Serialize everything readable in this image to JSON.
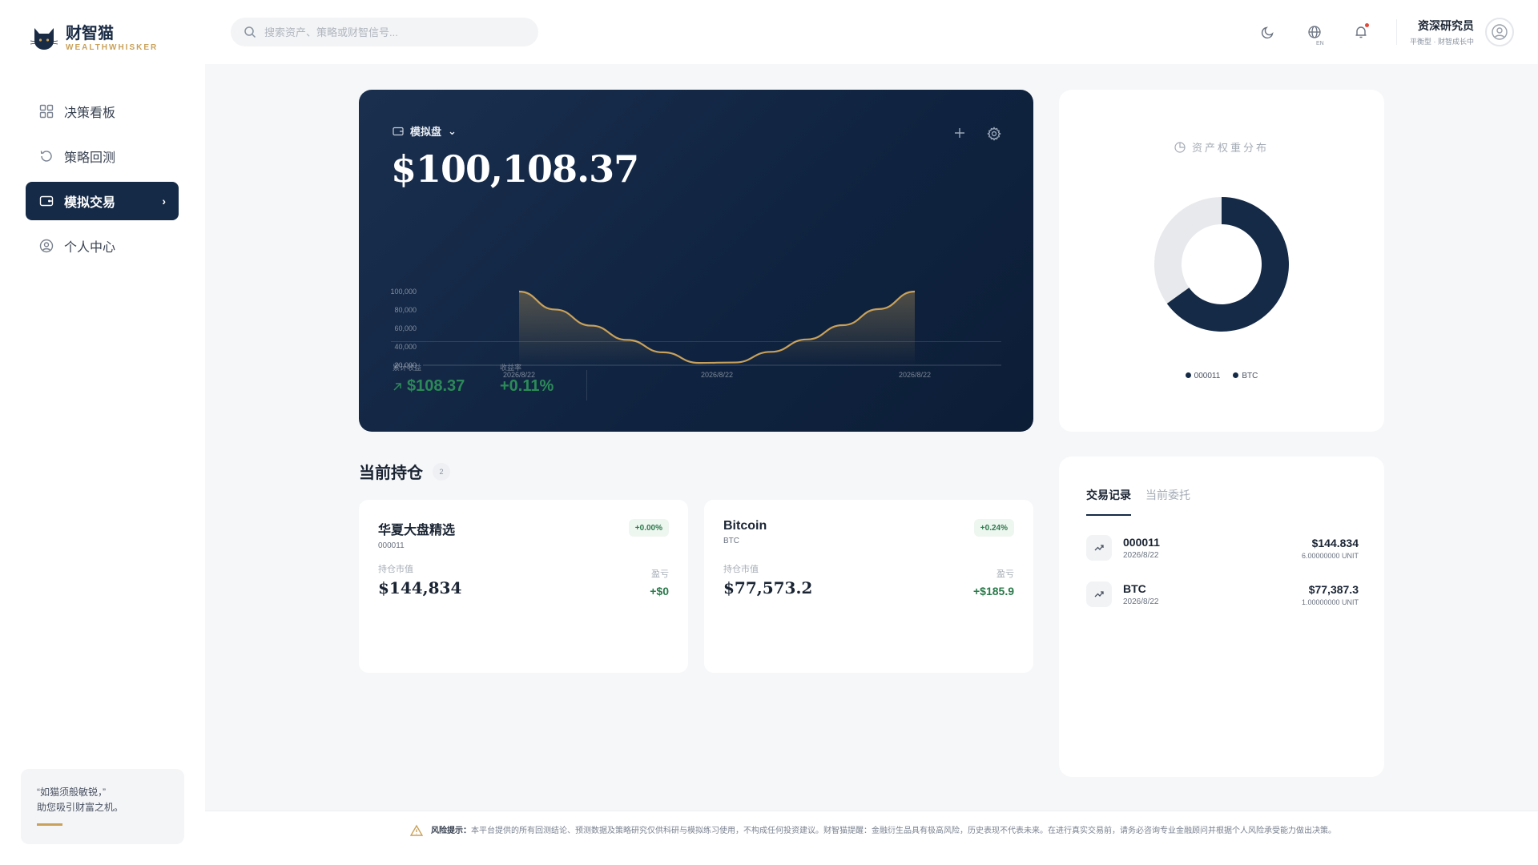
{
  "brand": {
    "name_cn": "财智猫",
    "name_en": "WEALTHWHISKER",
    "gold": "#c9a15a",
    "navy": "#152a47"
  },
  "sidebar": {
    "items": [
      {
        "label": "决策看板",
        "icon": "dashboard-icon"
      },
      {
        "label": "策略回测",
        "icon": "history-icon"
      },
      {
        "label": "模拟交易",
        "icon": "wallet-icon",
        "active": true
      },
      {
        "label": "个人中心",
        "icon": "user-circle-icon"
      }
    ],
    "quote_line1": "“如猫须般敏锐，”",
    "quote_line2": "助您吸引财富之机。"
  },
  "topbar": {
    "search_placeholder": "搜索资产、策略或财智信号...",
    "lang_sub": "EN",
    "user_name": "资深研究员",
    "user_sub": "平衡型 · 财智成长中"
  },
  "account": {
    "type_label": "模拟盘",
    "total_value": "$100,108.37",
    "stats": [
      {
        "label": "累计收益",
        "value": "$108.37"
      },
      {
        "label": "收益率",
        "value": "+0.11%"
      }
    ]
  },
  "chart_data": {
    "type": "area",
    "title": "",
    "xlabel": "",
    "ylabel": "",
    "x_ticks": [
      "2026/8/22",
      "2026/8/22",
      "2026/8/22"
    ],
    "y_ticks": [
      "100,000",
      "80,000",
      "60,000",
      "40,000",
      "20,000"
    ],
    "ylim": [
      20000,
      100000
    ],
    "series": [
      {
        "values": [
          100000,
          80500,
          63000,
          47500,
          34000,
          22500,
          23000,
          34500,
          48000,
          63500,
          81000,
          100000
        ]
      }
    ],
    "line_color": "#c9a15a",
    "grid": false
  },
  "allocation": {
    "title": "资产权重分布",
    "segments": [
      {
        "name": "000011",
        "value": 65.1,
        "color": "#152a47"
      },
      {
        "name": "BTC",
        "value": 34.9,
        "color": "#e8e9ec"
      }
    ],
    "legend": [
      "000011",
      "BTC"
    ]
  },
  "holdings": {
    "title": "当前持仓",
    "count": "2",
    "value_label": "持仓市值",
    "pnl_label": "盈亏",
    "items": [
      {
        "name": "华夏大盘精选",
        "code": "000011",
        "change": "+0.00%",
        "value": "$144,834",
        "pnl": "+$0"
      },
      {
        "name": "Bitcoin",
        "code": "BTC",
        "change": "+0.24%",
        "value": "$77,573.2",
        "pnl": "+$185.9"
      }
    ]
  },
  "transactions": {
    "tabs": [
      "交易记录",
      "当前委托"
    ],
    "rows": [
      {
        "name": "000011",
        "date": "2026/8/22",
        "amount": "$144.834",
        "qty": "6.00000000 UNIT"
      },
      {
        "name": "BTC",
        "date": "2026/8/22",
        "amount": "$77,387.3",
        "qty": "1.00000000 UNIT"
      }
    ]
  },
  "footer": {
    "label": "风险提示：",
    "text": "本平台提供的所有回测结论、预测数据及策略研究仅供科研与模拟练习使用，不构成任何投资建议。财智猫提醒：金融衍生品具有极高风险，历史表现不代表未来。在进行真实交易前，请务必咨询专业金融顾问并根据个人风险承受能力做出决策。"
  }
}
